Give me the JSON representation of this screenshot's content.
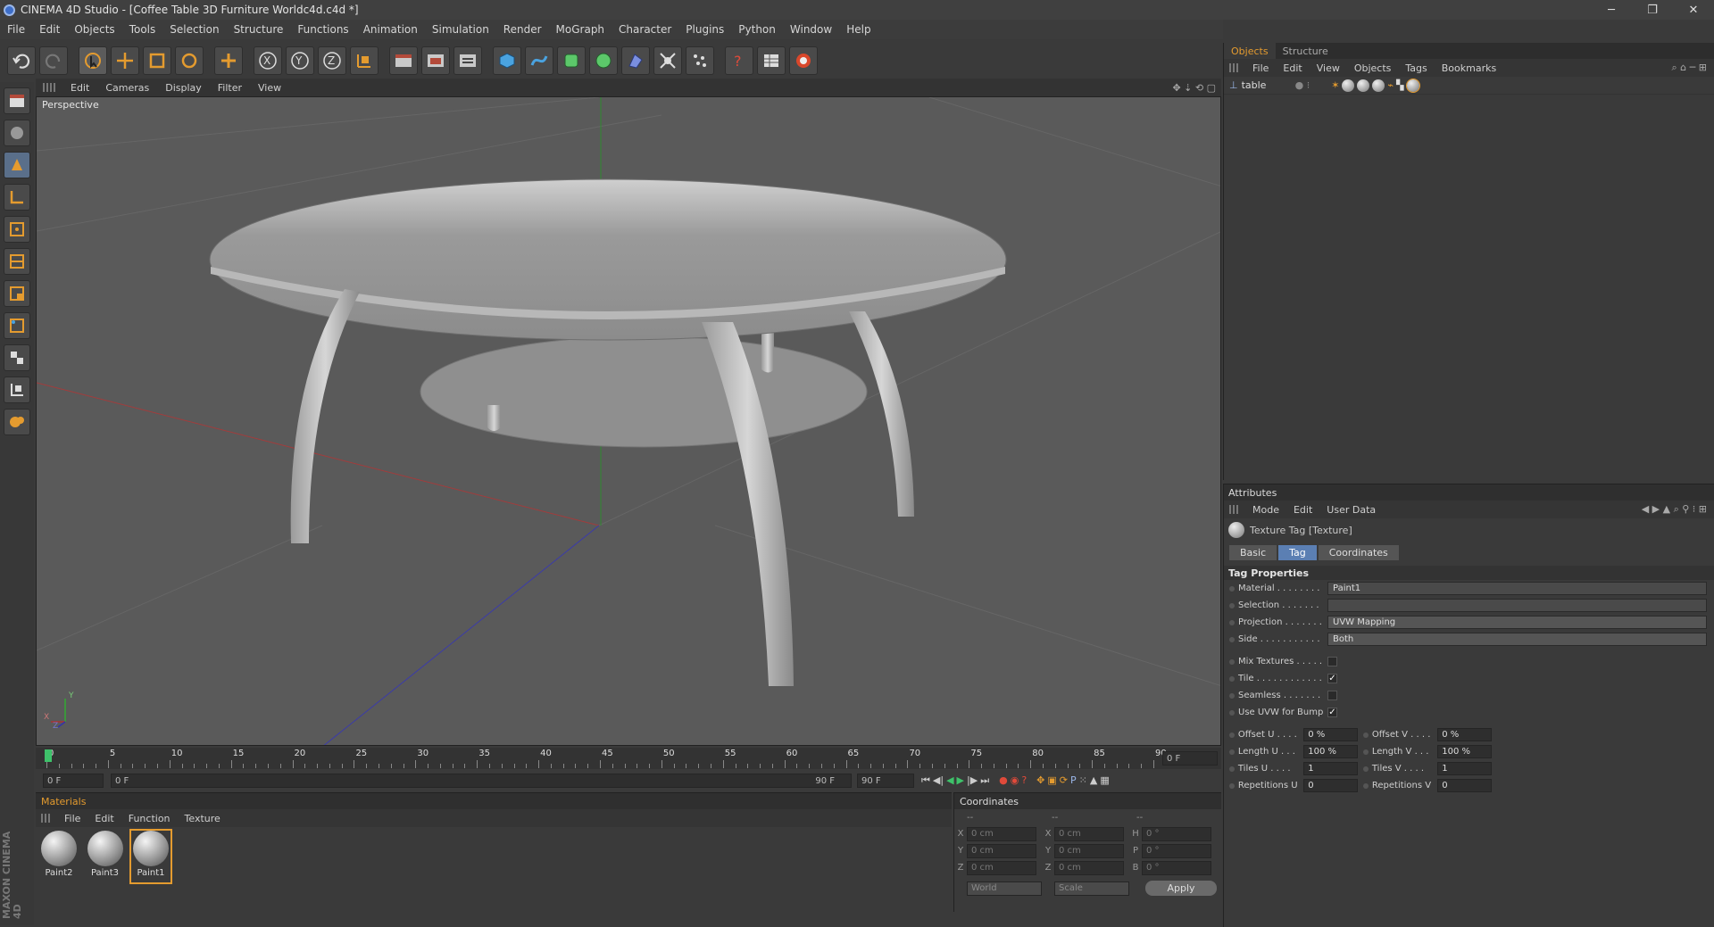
{
  "window": {
    "title": "CINEMA 4D Studio - [Coffee Table 3D Furniture Worldc4d.c4d *]"
  },
  "menu": [
    "File",
    "Edit",
    "Objects",
    "Tools",
    "Selection",
    "Structure",
    "Functions",
    "Animation",
    "Simulation",
    "Render",
    "MoGraph",
    "Character",
    "Plugins",
    "Python",
    "Window",
    "Help"
  ],
  "toolbar_icons": [
    "undo-icon",
    "redo-icon",
    "live-select-icon",
    "move-icon",
    "scale-icon",
    "rotate-icon",
    "add-icon",
    "x-axis-icon",
    "y-axis-icon",
    "z-axis-icon",
    "world-coords-icon",
    "render-view-icon",
    "render-pv-icon",
    "render-settings-icon",
    "cube-icon",
    "spline-icon",
    "nurbs-icon",
    "array-icon",
    "deformer-icon",
    "scene-icon",
    "particles-icon",
    "help-icon",
    "timeline-icon",
    "python-icon"
  ],
  "viewport": {
    "menu": [
      "Edit",
      "Cameras",
      "Display",
      "Filter",
      "View"
    ],
    "label": "Perspective",
    "axis_labels": {
      "y": "Y",
      "x": "X",
      "z": "Z"
    }
  },
  "timeline": {
    "ticks": [
      "0",
      "5",
      "10",
      "15",
      "20",
      "25",
      "30",
      "35",
      "40",
      "45",
      "50",
      "55",
      "60",
      "65",
      "70",
      "75",
      "80",
      "85",
      "90"
    ],
    "current_frame": "0 F",
    "start_field": "0 F",
    "range_start": "0 F",
    "range_end": "90 F",
    "end_field": "90 F"
  },
  "materials": {
    "title": "Materials",
    "menu": [
      "File",
      "Edit",
      "Function",
      "Texture"
    ],
    "items": [
      {
        "name": "Paint2"
      },
      {
        "name": "Paint3"
      },
      {
        "name": "Paint1"
      }
    ],
    "selected": 2
  },
  "coordinates": {
    "title": "Coordinates",
    "col_heads": [
      "--",
      "--",
      "--"
    ],
    "rows": [
      {
        "a": "X",
        "av": "0 cm",
        "b": "X",
        "bv": "0 cm",
        "c": "H",
        "cv": "0 °"
      },
      {
        "a": "Y",
        "av": "0 cm",
        "b": "Y",
        "bv": "0 cm",
        "c": "P",
        "cv": "0 °"
      },
      {
        "a": "Z",
        "av": "0 cm",
        "b": "Z",
        "bv": "0 cm",
        "c": "B",
        "cv": "0 °"
      }
    ],
    "mode1": "World",
    "mode2": "Scale",
    "apply": "Apply"
  },
  "objects": {
    "tabs": [
      "Objects",
      "Structure"
    ],
    "menu": [
      "File",
      "Edit",
      "View",
      "Objects",
      "Tags",
      "Bookmarks"
    ],
    "items": [
      {
        "name": "table"
      }
    ]
  },
  "attributes": {
    "title": "Attributes",
    "menu": [
      "Mode",
      "Edit",
      "User Data"
    ],
    "header": "Texture Tag [Texture]",
    "tabs": [
      "Basic",
      "Tag",
      "Coordinates"
    ],
    "active_tab": "Tag",
    "section": "Tag Properties",
    "material_label": "Material . . . . . . . .",
    "material_value": "Paint1",
    "selection_label": "Selection . . . . . . .",
    "selection_value": "",
    "projection_label": "Projection . . . . . . .",
    "projection_value": "UVW Mapping",
    "side_label": "Side . . . . . . . . . . .",
    "side_value": "Both",
    "mix_label": "Mix Textures . . . . .",
    "mix_checked": "",
    "tile_label": "Tile . . . . . . . . . . . .",
    "tile_checked": "✓",
    "seamless_label": "Seamless . . . . . . .",
    "seamless_checked": "",
    "uvw_label": "Use UVW for Bump",
    "uvw_checked": "✓",
    "offset_u_label": "Offset U . . . .",
    "offset_u": "0 %",
    "offset_v_label": "Offset V . . . .",
    "offset_v": "0 %",
    "length_u_label": "Length U . . .",
    "length_u": "100 %",
    "length_v_label": "Length V . . .",
    "length_v": "100 %",
    "tiles_u_label": "Tiles U . . . .",
    "tiles_u": "1",
    "tiles_v_label": "Tiles V . . . .",
    "tiles_v": "1",
    "rep_u_label": "Repetitions U",
    "rep_u": "0",
    "rep_v_label": "Repetitions V",
    "rep_v": "0"
  },
  "branding": "MAXON CINEMA 4D"
}
